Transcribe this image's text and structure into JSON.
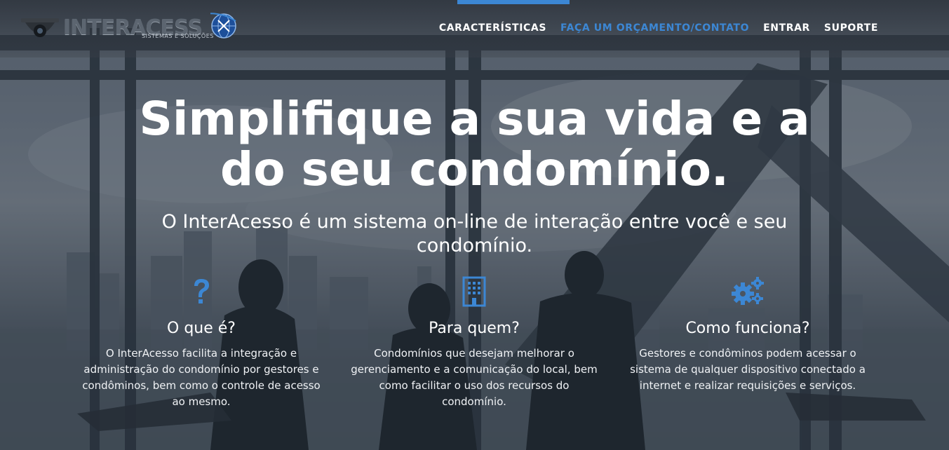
{
  "brand": {
    "name": "INTERACESS",
    "tagline": "SISTEMAS E SOLUÇÕES",
    "logo_icons": [
      "security-camera-icon",
      "globe-icon"
    ]
  },
  "nav": {
    "items": [
      {
        "label": "CARACTERÍSTICAS",
        "active": false
      },
      {
        "label": "FAÇA UM ORÇAMENTO/CONTATO",
        "active": true
      },
      {
        "label": "ENTRAR",
        "active": false
      },
      {
        "label": "SUPORTE",
        "active": false
      }
    ]
  },
  "hero": {
    "title_line1": "Simplifique a sua vida e a",
    "title_line2": "do seu condomínio.",
    "subtitle": "O InterAcesso é um sistema on-line de interação entre você e seu condomínio."
  },
  "features": [
    {
      "icon": "question-icon",
      "title": "O que é?",
      "text": "O InterAcesso facilita a integração e administração do condomínio por gestores e condôminos, bem como o controle de acesso ao mesmo."
    },
    {
      "icon": "building-icon",
      "title": "Para quem?",
      "text": "Condomínios que desejam melhorar o gerenciamento e a comunicação do local, bem como facilitar o uso dos recursos do condomínio."
    },
    {
      "icon": "gears-icon",
      "title": "Como funciona?",
      "text": "Gestores e condôminos podem acessar o sistema de qualquer dispositivo conectado a internet e realizar requisições e serviços."
    }
  ],
  "colors": {
    "accent": "#3c87d4",
    "text": "#ffffff",
    "overlay": "#1e2834"
  }
}
